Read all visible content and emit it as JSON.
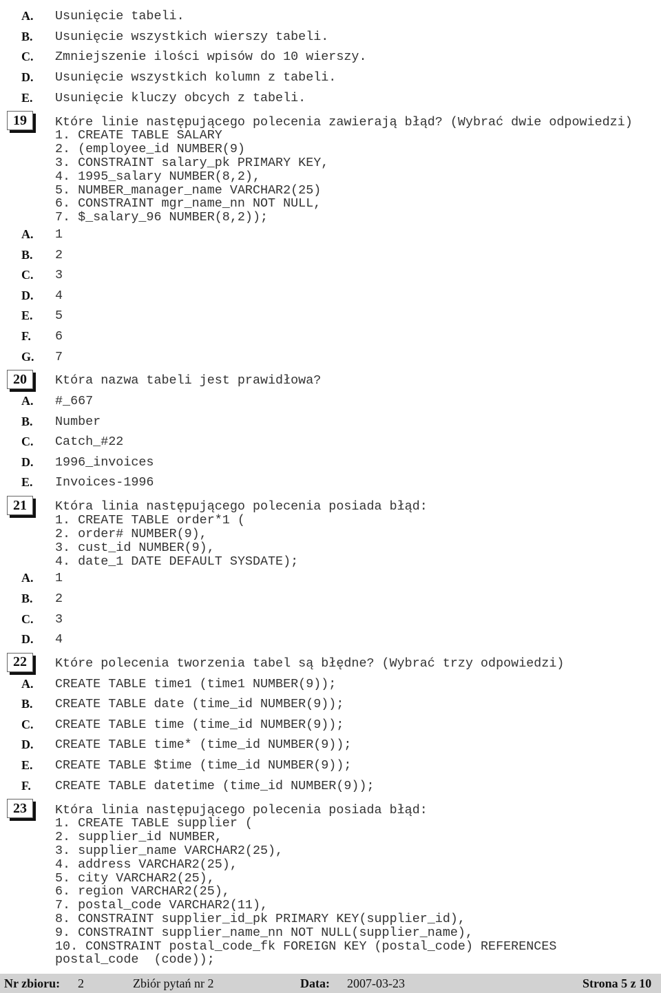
{
  "blocks": [
    {
      "type": "answers",
      "items": [
        {
          "letter": "A.",
          "text": "Usunięcie tabeli."
        },
        {
          "letter": "B.",
          "text": "Usunięcie wszystkich wierszy tabeli."
        },
        {
          "letter": "C.",
          "text": "Zmniejszenie ilości wpisów do 10 wierszy."
        },
        {
          "letter": "D.",
          "text": "Usunięcie wszystkich kolumn z tabeli."
        },
        {
          "letter": "E.",
          "text": "Usunięcie kluczy obcych z tabeli."
        }
      ]
    },
    {
      "type": "question",
      "number": "19",
      "text": "Które linie następującego polecenia zawierają błąd? (Wybrać dwie odpowiedzi)",
      "code": [
        "1. CREATE TABLE SALARY",
        "2. (employee_id NUMBER(9)",
        "3. CONSTRAINT salary_pk PRIMARY KEY,",
        "4. 1995_salary NUMBER(8,2),",
        "5. NUMBER_manager_name VARCHAR2(25)",
        "6. CONSTRAINT mgr_name_nn NOT NULL,",
        "7. $_salary_96 NUMBER(8,2));"
      ],
      "answers": [
        {
          "letter": "A.",
          "text": "1"
        },
        {
          "letter": "B.",
          "text": "2"
        },
        {
          "letter": "C.",
          "text": "3"
        },
        {
          "letter": "D.",
          "text": "4"
        },
        {
          "letter": "E.",
          "text": "5"
        },
        {
          "letter": "F.",
          "text": "6"
        },
        {
          "letter": "G.",
          "text": "7"
        }
      ]
    },
    {
      "type": "question",
      "number": "20",
      "text": "Która nazwa tabeli jest prawidłowa?",
      "code": [],
      "answers": [
        {
          "letter": "A.",
          "text": "#_667"
        },
        {
          "letter": "B.",
          "text": "Number"
        },
        {
          "letter": "C.",
          "text": "Catch_#22"
        },
        {
          "letter": "D.",
          "text": "1996_invoices"
        },
        {
          "letter": "E.",
          "text": "Invoices-1996"
        }
      ]
    },
    {
      "type": "question",
      "number": "21",
      "text": "Która linia następującego polecenia posiada błąd:",
      "code": [
        "1. CREATE TABLE order*1 (",
        "2. order# NUMBER(9),",
        "3. cust_id NUMBER(9),",
        "4. date_1 DATE DEFAULT SYSDATE);"
      ],
      "answers": [
        {
          "letter": "A.",
          "text": "1"
        },
        {
          "letter": "B.",
          "text": "2"
        },
        {
          "letter": "C.",
          "text": "3"
        },
        {
          "letter": "D.",
          "text": "4"
        }
      ]
    },
    {
      "type": "question",
      "number": "22",
      "text": "Które polecenia tworzenia tabel są błędne? (Wybrać trzy odpowiedzi)",
      "code": [],
      "answers": [
        {
          "letter": "A.",
          "text": "CREATE TABLE time1 (time1 NUMBER(9));"
        },
        {
          "letter": "B.",
          "text": "CREATE TABLE date (time_id NUMBER(9));"
        },
        {
          "letter": "C.",
          "text": "CREATE TABLE time (time_id NUMBER(9));"
        },
        {
          "letter": "D.",
          "text": "CREATE TABLE time* (time_id NUMBER(9));"
        },
        {
          "letter": "E.",
          "text": "CREATE TABLE $time (time_id NUMBER(9));"
        },
        {
          "letter": "F.",
          "text": "CREATE TABLE datetime (time_id NUMBER(9));"
        }
      ]
    },
    {
      "type": "question",
      "number": "23",
      "text": "Która linia następującego polecenia posiada błąd:",
      "code": [
        "1. CREATE TABLE supplier (",
        "2. supplier_id NUMBER,",
        "3. supplier_name VARCHAR2(25),",
        "4. address VARCHAR2(25),",
        "5. city VARCHAR2(25),",
        "6. region VARCHAR2(25),",
        "7. postal_code VARCHAR2(11),",
        "8. CONSTRAINT supplier_id_pk PRIMARY KEY(supplier_id),",
        "9. CONSTRAINT supplier_name_nn NOT NULL(supplier_name),",
        "10. CONSTRAINT postal_code_fk FOREIGN KEY (postal_code) REFERENCES",
        "postal_code  (code));"
      ],
      "answers": []
    }
  ],
  "footer": {
    "set_label": "Nr zbioru:",
    "set_value": "2",
    "set_name": "Zbiór pytań nr 2",
    "date_label": "Data:",
    "date_value": "2007-03-23",
    "page": "Strona 5 z 10"
  }
}
